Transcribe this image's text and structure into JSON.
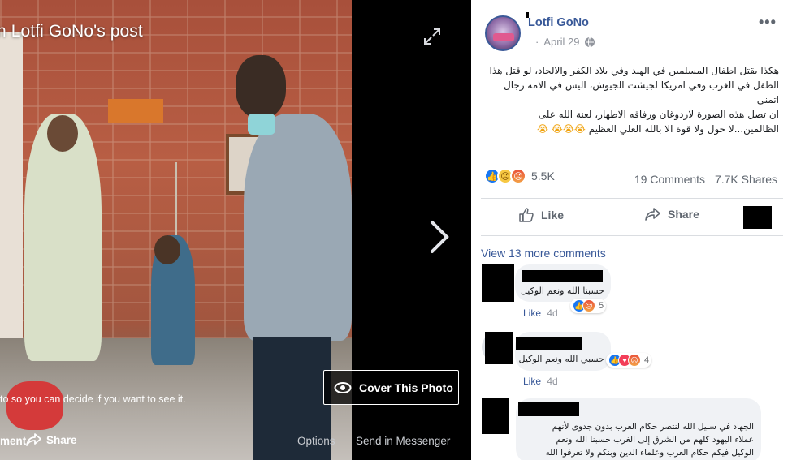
{
  "viewer": {
    "title": "n Lotfi GoNo's post",
    "warning": "to so you can decide if you want to see it.",
    "cover_button": "Cover This Photo",
    "bottom": {
      "comment": "ment",
      "share": "Share",
      "options": "Options",
      "messenger": "Send in Messenger"
    }
  },
  "post": {
    "author": "Lotfi GoNo",
    "date": "April 29",
    "dot": "·",
    "text_lines": [
      "هكذا يقتل اطفال المسلمين في الهند وفي بلاد الكفر والالحاد، لو قتل هذا",
      "الطفل في الغرب وفي امريكا لجيشت الجيوش، اليس في الامة رجال اتمنى",
      "ان تصل هذه الصورة لاردوغان ورفاقه الاطهار، لعنة الله على",
      "الظالمين...لا حول ولا قوة الا بالله العلي العظيم"
    ],
    "text_emoji": "😭😭😭 😭",
    "reaction_count": "5.5K",
    "comments_count": "19 Comments",
    "shares_count": "7.7K Shares",
    "like_label": "Like",
    "share_label": "Share",
    "more_label": "•••"
  },
  "comments": {
    "view_more": "View 13 more comments",
    "items": [
      {
        "text": "حسبنا الله ونعم الوكيل",
        "reactions": "5",
        "like": "Like",
        "time": "4d"
      },
      {
        "text": "حسبي الله ونعم الوكيل",
        "reactions": "4",
        "like": "Like",
        "time": "4d"
      },
      {
        "lines": [
          "الجهاد في سبيل الله لنتصر حكام العرب بدون جدوى لأنهم",
          "عملاء اليهود كلهم من الشرق إلى الغرب حسبنا الله ونعم",
          "الوكيل فيكم حكام العرب وعلماء الدين وبنكم ولا تعرفوا الله"
        ]
      }
    ]
  },
  "colors": {
    "link": "#385898",
    "muted": "#606770",
    "like_blue": "#1877f2"
  }
}
